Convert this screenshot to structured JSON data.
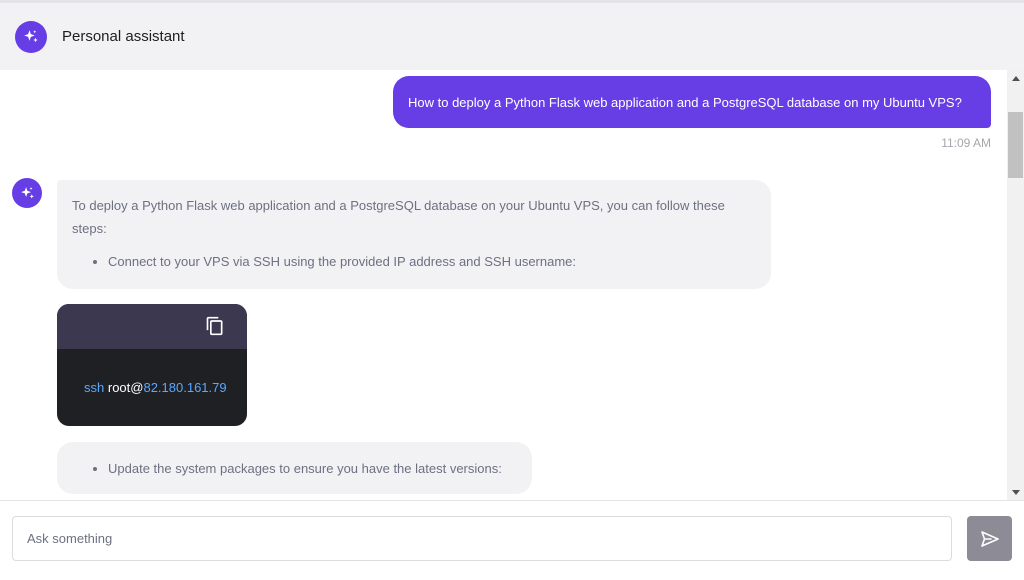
{
  "header": {
    "title": "Personal assistant",
    "avatar_icon": "sparkles-icon"
  },
  "messages": {
    "user_message": "How to deploy a Python Flask web application and a PostgreSQL database on my Ubuntu VPS?",
    "user_timestamp": "11:09 AM",
    "assistant_intro": "To deploy a Python Flask web application and a PostgreSQL database on your Ubuntu VPS, you can follow these steps:",
    "assistant_steps": [
      "Connect to your VPS via SSH using the provided IP address and SSH username:",
      "Update the system packages to ensure you have the latest versions:"
    ],
    "code": {
      "command": "ssh",
      "user": "root@",
      "host": "82.180.161.79",
      "copy_icon": "copy-icon"
    }
  },
  "composer": {
    "placeholder": "Ask something",
    "value": "",
    "send_icon": "send-icon"
  },
  "colors": {
    "accent": "#673de6",
    "header_bg": "#f2f2f5",
    "bubble_bg": "#f2f2f5",
    "code_bg": "#1f2023",
    "code_header_bg": "#3b3850",
    "send_button_bg": "#8c8b96"
  }
}
